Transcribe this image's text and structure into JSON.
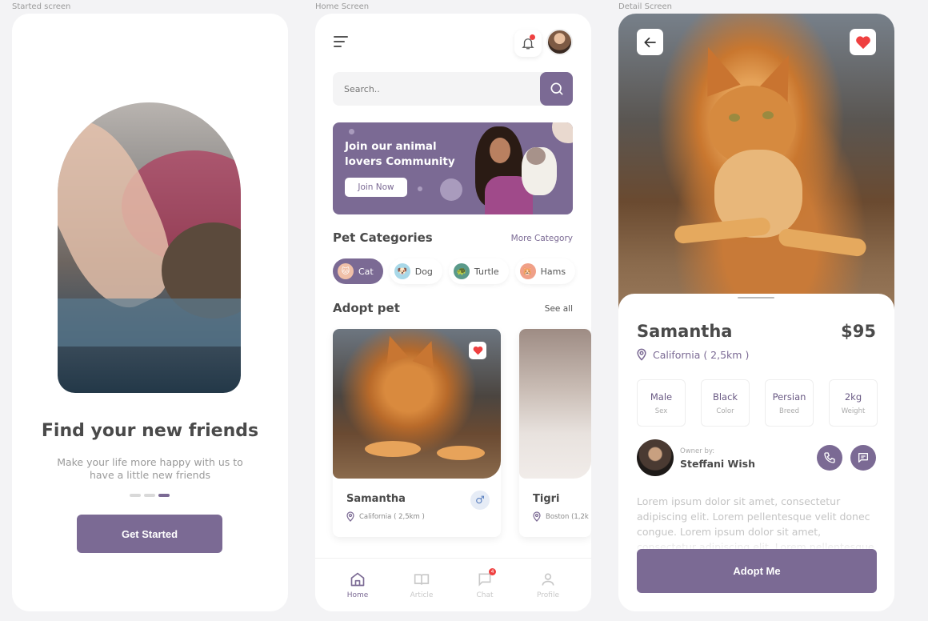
{
  "labels": {
    "started": "Started screen",
    "home": "Home Screen",
    "detail": "Detail Screen"
  },
  "started": {
    "title": "Find your new friends",
    "subtitle": "Make your life more happy with us to have a little new friends",
    "page_indicator": {
      "current": 3,
      "total": 3
    },
    "button": "Get Started"
  },
  "home": {
    "search_placeholder": "Search..",
    "notification_unread": true,
    "banner": {
      "title": "Join our animal lovers Community",
      "button": "Join Now"
    },
    "categories": {
      "title": "Pet Categories",
      "more": "More Category",
      "items": [
        {
          "label": "Cat",
          "icon": "cat-icon",
          "active": true
        },
        {
          "label": "Dog",
          "icon": "dog-icon",
          "active": false
        },
        {
          "label": "Turtle",
          "icon": "turtle-icon",
          "active": false
        },
        {
          "label": "Hams",
          "icon": "hamster-icon",
          "active": false
        }
      ]
    },
    "adopt": {
      "title": "Adopt pet",
      "see_all": "See all",
      "pets": [
        {
          "name": "Samantha",
          "location": "California ( 2,5km )",
          "gender": "male",
          "favorite": true
        },
        {
          "name": "Tigri",
          "location": "Boston (1,2k"
        }
      ]
    },
    "nav": [
      {
        "label": "Home",
        "icon": "home-icon",
        "active": true
      },
      {
        "label": "Article",
        "icon": "book-icon",
        "active": false
      },
      {
        "label": "Chat",
        "icon": "chat-icon",
        "active": false,
        "badge": "4"
      },
      {
        "label": "Profile",
        "icon": "profile-icon",
        "active": false
      }
    ]
  },
  "detail": {
    "name": "Samantha",
    "price": "$95",
    "location": "California ( 2,5km )",
    "favorite": true,
    "attributes": [
      {
        "value": "Male",
        "key": "Sex"
      },
      {
        "value": "Black",
        "key": "Color"
      },
      {
        "value": "Persian",
        "key": "Breed"
      },
      {
        "value": "2kg",
        "key": "Weight"
      }
    ],
    "owner_label": "Owner by:",
    "owner_name": "Steffani Wish",
    "description": "Lorem ipsum dolor sit amet, consectetur adipiscing elit. Lorem pellentesque velit donec congue. Lorem ipsum dolor sit amet, consectetur adipiscing elit. Lorem pellentesque",
    "button": "Adopt Me"
  },
  "colors": {
    "primary": "#7b6a94",
    "heart": "#ef4040",
    "background": "#f3f3f5"
  }
}
